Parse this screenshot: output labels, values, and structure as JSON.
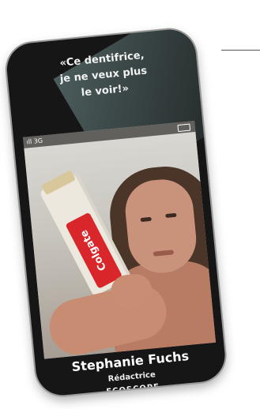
{
  "quote": "«Ce dentifrice,\nje ne veux plus\nle voir!»",
  "status": {
    "signal": "ıll 3G"
  },
  "product": {
    "brand": "Colgate"
  },
  "person": {
    "name": "Stephanie Fuchs",
    "role": "Rédactrice",
    "publication": "ECOSCOPE"
  }
}
